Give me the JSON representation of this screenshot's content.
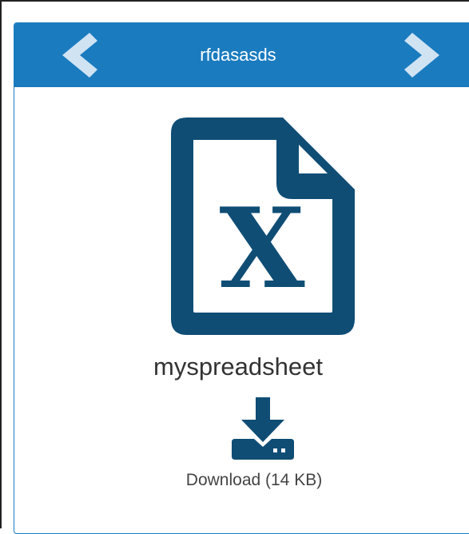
{
  "header": {
    "title": "rfdasasds",
    "prev_icon": "chevron-left-icon",
    "next_icon": "chevron-right-icon"
  },
  "file": {
    "name": "myspreadsheet",
    "icon": "excel-file-icon"
  },
  "download": {
    "label": "Download (14 KB)",
    "icon": "download-icon"
  },
  "colors": {
    "header_bg": "#1a7bbf",
    "chevron": "#cfe3f3",
    "icon_navy": "#0f4d75",
    "text": "#333333"
  }
}
